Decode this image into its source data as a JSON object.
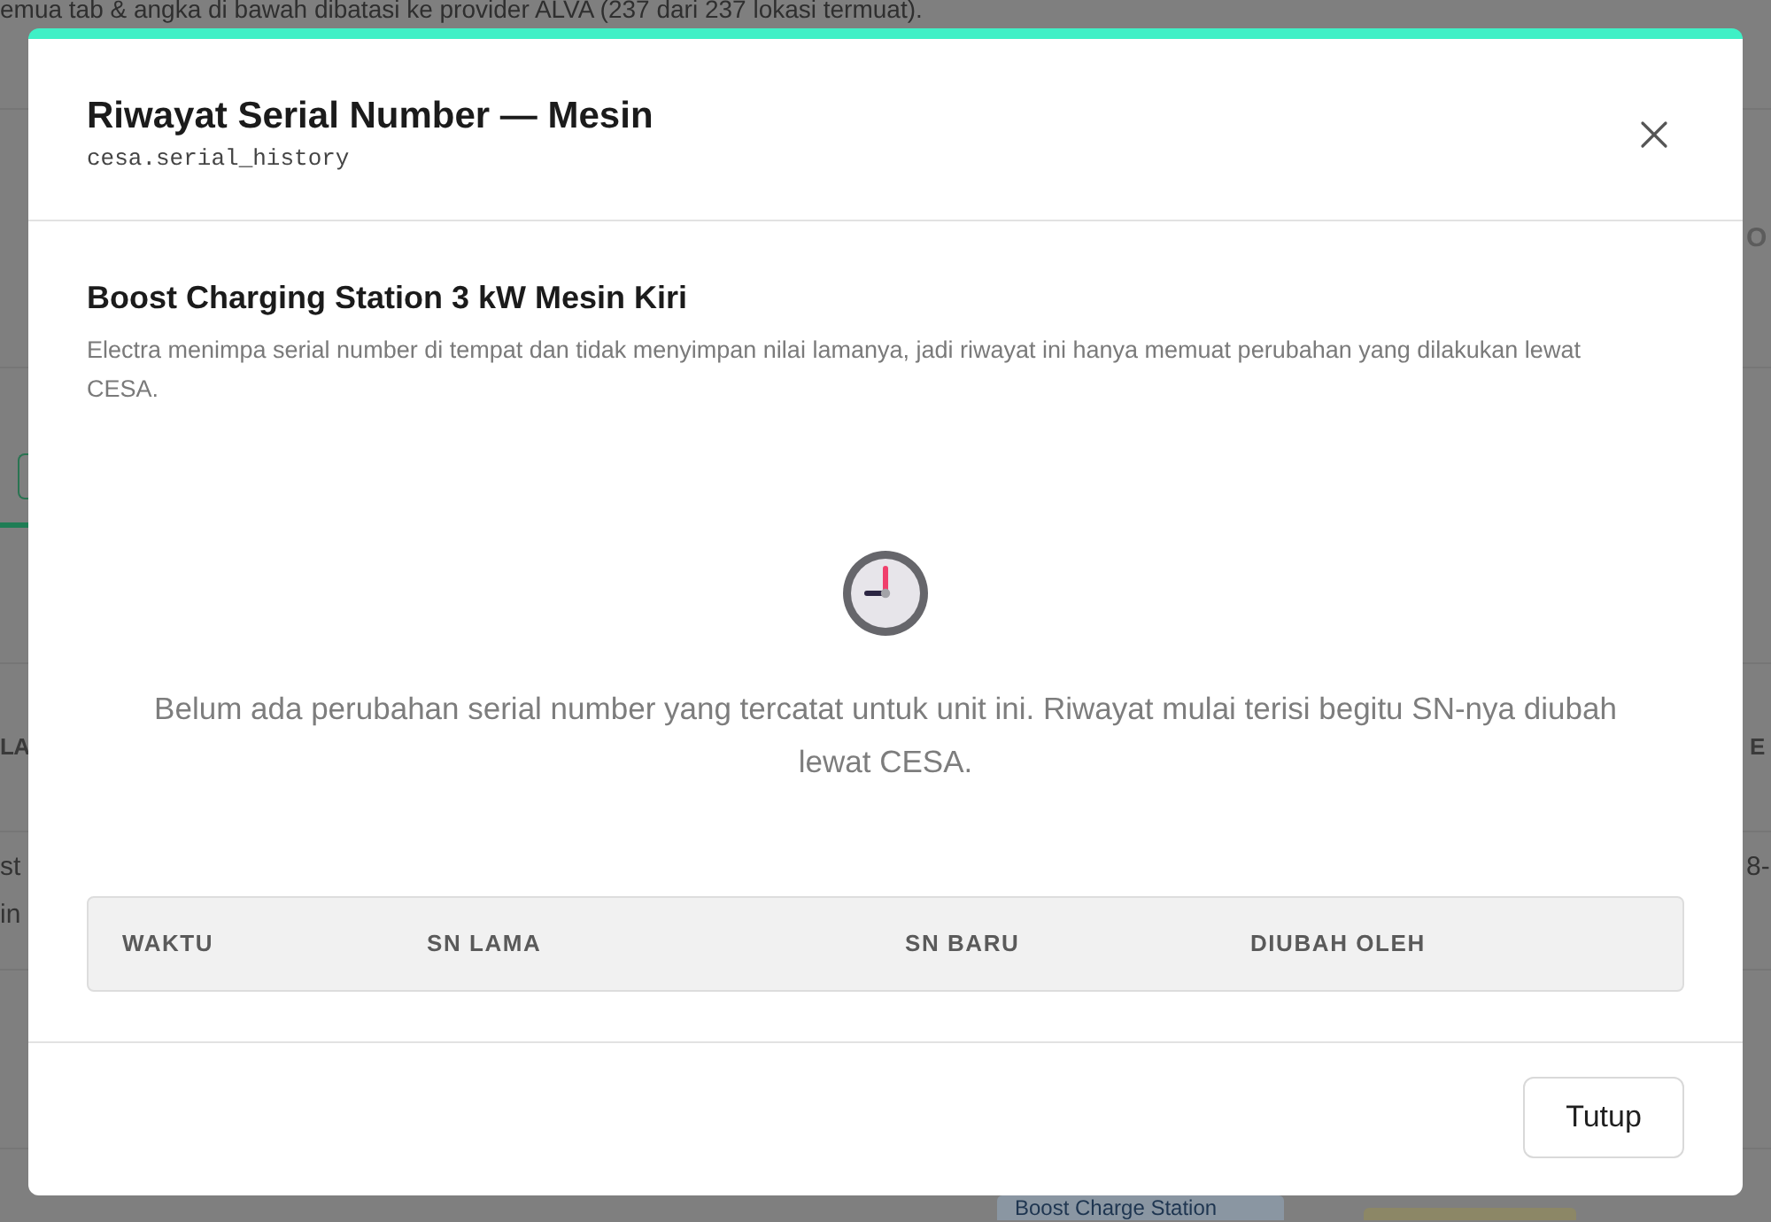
{
  "background": {
    "notice": "emua tab & angka di bawah dibatasi ke provider ALVA (237 dari 237 lokasi termuat).",
    "right_heading_fragment": "O",
    "table_header_left": "LA",
    "table_header_right": "E",
    "row_left_lines": [
      "st",
      "in"
    ],
    "row_right": "8-",
    "bottom_tag": "Boost Charge Station"
  },
  "dialog": {
    "title": "Riwayat Serial Number — Mesin",
    "subtitle": "cesa.serial_history",
    "section_title": "Boost Charging Station 3 kW Mesin Kiri",
    "description": "Electra menimpa serial number di tempat dan tidak menyimpan nilai lamanya, jadi riwayat ini hanya memuat perubahan yang dilakukan lewat CESA.",
    "empty_message": "Belum ada perubahan serial number yang tercatat untuk unit ini. Riwayat mulai terisi begitu SN-nya diubah lewat CESA.",
    "table": {
      "columns": [
        "WAKTU",
        "SN LAMA",
        "SN BARU",
        "DIUBAH OLEH"
      ]
    },
    "buttons": [
      "Tutup"
    ]
  }
}
